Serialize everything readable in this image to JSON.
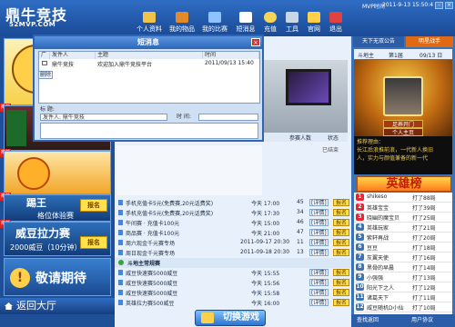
{
  "app": {
    "title": "鼎牛竞技",
    "subtitle": "52MVP.COM"
  },
  "nav": [
    {
      "label": "个人资料"
    },
    {
      "label": "我的物品"
    },
    {
      "label": "我的比赛"
    },
    {
      "label": "短消息"
    },
    {
      "label": "充值"
    },
    {
      "label": "工具"
    },
    {
      "label": "官网"
    },
    {
      "label": "退出"
    }
  ],
  "window": {
    "mvp_label": "MVP时间",
    "datetime": "2011-9-13 15:50:4",
    "min": "-",
    "close": "×"
  },
  "left": {
    "ad1_tag": "推荐",
    "ad2_tag": "推荐",
    "ad3_tag": "推荐",
    "ad4_tag": "推荐",
    "match1_title": "踢王",
    "match1_sub": "格位体验赛",
    "match1_btn": "报名",
    "match2_title": "威豆拉力赛",
    "match2_sub": "2000威豆（10分钟）",
    "match2_btn": "报名",
    "coming_soon": "敬请期待",
    "back_hall": "返回大厅"
  },
  "dialog": {
    "title": "短消息",
    "close": "×",
    "headers": [
      "广",
      "发件人",
      "主题",
      "时间"
    ],
    "rows": [
      {
        "sender": "鼎牛竞技",
        "subject": "欢迎加入鼎牛竞技平台",
        "time": "2011/09/13 15:40"
      }
    ],
    "delete_btn": "删除",
    "form_subject_label": "标  题:",
    "form_sender_label": "发件人: 鼎牛竞技",
    "form_time_label": "时  间:"
  },
  "center": {
    "col_people": "参赛人数",
    "col_status": "状态",
    "section_label": "斗地主常规赛",
    "matches": [
      {
        "name": "手机充值卡5元(免费赛,20元话费奖)",
        "time": "今天 17:00",
        "count": "45",
        "detail": "[详情]",
        "btn": "报名"
      },
      {
        "name": "手机充值卡5元(免费赛,20元话费奖)",
        "time": "今天 17:30",
        "count": "34",
        "detail": "[详情]",
        "btn": "报名"
      },
      {
        "name": "午间赛 · 充值卡100元",
        "time": "今天 15:00",
        "count": "46",
        "detail": "[详情]",
        "btn": "报名"
      },
      {
        "name": "商品赛 · 充值卡100元",
        "time": "今天 21:00",
        "count": "47",
        "detail": "[详情]",
        "btn": "报名"
      },
      {
        "name": "周六现金千元赛专场",
        "time": "2011-09-17 20:30",
        "count": "11",
        "detail": "[详情]",
        "btn": "报名"
      },
      {
        "name": "周日现金千元赛专场",
        "time": "2011-09-18 20:30",
        "count": "13",
        "detail": "[详情]",
        "btn": "报名"
      },
      {
        "name": "威豆快速赛5000威豆",
        "time": "今天 15:55",
        "count": "",
        "detail": "[详情]",
        "btn": "报名"
      },
      {
        "name": "威豆快速赛5000威豆",
        "time": "今天 15:56",
        "count": "",
        "detail": "[详情]",
        "btn": "报名"
      },
      {
        "name": "威豆快速赛5000威豆",
        "time": "今天 15:58",
        "count": "",
        "detail": "[详情]",
        "btn": "报名"
      },
      {
        "name": "英雄拉力赛500威豆",
        "time": "今天 16:00",
        "count": "",
        "detail": "[详情]",
        "btn": "报名"
      }
    ],
    "switch_game": "切换游戏",
    "status_right": [
      "已结束",
      "报名"
    ]
  },
  "right": {
    "tab1": "天下无双公告",
    "tab2": "明星战手",
    "rank_title": "斗地主",
    "rank_date": "第1届",
    "rank_date2": "09/13 日",
    "btn1": "足养开门",
    "btn2": "个人主页",
    "recommend_lines": [
      "推荐理由：",
      "长江后浪推前浪，一代新人换旧",
      "人，实力与颜值兼备的新一代"
    ],
    "heroes_title": "英雄榜",
    "heroes": [
      {
        "rank": "1",
        "name": "shikeso",
        "score": "打了88局"
      },
      {
        "rank": "2",
        "name": "英雄宝宝",
        "score": "打了39局"
      },
      {
        "rank": "3",
        "name": "晓幽的魔宝贝",
        "score": "打了25局"
      },
      {
        "rank": "4",
        "name": "英雄玩家",
        "score": "打了21局"
      },
      {
        "rank": "5",
        "name": "紫轩再战",
        "score": "打了20局"
      },
      {
        "rank": "6",
        "name": "豆豆",
        "score": "打了18局"
      },
      {
        "rank": "7",
        "name": "灰翼天使",
        "score": "打了16局"
      },
      {
        "rank": "8",
        "name": "黑骨的早晨",
        "score": "打了14局"
      },
      {
        "rank": "9",
        "name": "小强强",
        "score": "打了13局"
      },
      {
        "rank": "10",
        "name": "阳光下之人",
        "score": "打了12局"
      },
      {
        "rank": "11",
        "name": "诸葛天下",
        "score": "打了11局"
      },
      {
        "rank": "12",
        "name": "威豆随机D小仙",
        "score": "打了10局"
      }
    ],
    "bottom_left": "查找返回",
    "bottom_right": "用户协议"
  },
  "colors": {
    "accent": "#2f6dc4",
    "gold": "#ffe24a",
    "alert": "#d22222"
  }
}
